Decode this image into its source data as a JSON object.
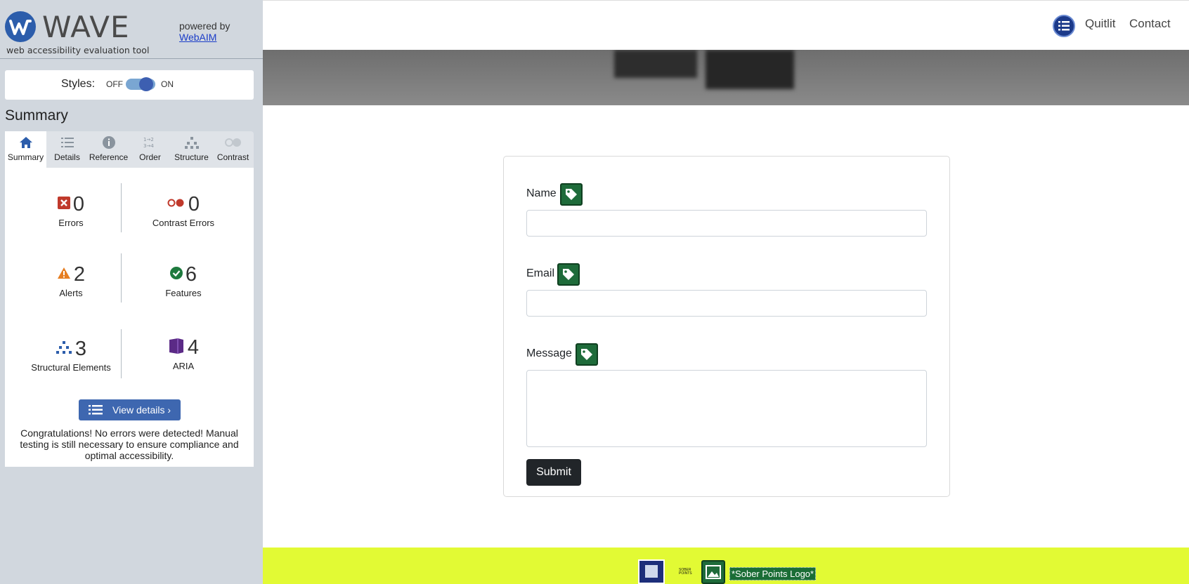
{
  "wave": {
    "title": "WAVE",
    "subtitle": "web accessibility evaluation tool",
    "powered_by": "powered by",
    "webaim_link": "WebAIM",
    "styles_label": "Styles:",
    "toggle_off": "OFF",
    "toggle_on": "ON",
    "styles_enabled": true,
    "summary_heading": "Summary",
    "tabs": [
      {
        "label": "Summary",
        "icon": "home-icon",
        "active": true
      },
      {
        "label": "Details",
        "icon": "list-icon"
      },
      {
        "label": "Reference",
        "icon": "info-icon"
      },
      {
        "label": "Order",
        "icon": "order-icon"
      },
      {
        "label": "Structure",
        "icon": "structure-icon"
      },
      {
        "label": "Contrast",
        "icon": "contrast-icon"
      }
    ],
    "stats": {
      "errors": {
        "count": "0",
        "label": "Errors",
        "icon": "error-icon",
        "color": "#c0392b"
      },
      "contrast_errors": {
        "count": "0",
        "label": "Contrast Errors",
        "icon": "contrast-error-icon",
        "color": "#c0392b"
      },
      "alerts": {
        "count": "2",
        "label": "Alerts",
        "icon": "alert-icon",
        "color": "#e67e22"
      },
      "features": {
        "count": "6",
        "label": "Features",
        "icon": "feature-icon",
        "color": "#1e7a3e"
      },
      "structural": {
        "count": "3",
        "label": "Structural Elements",
        "icon": "structure-icon",
        "color": "#2c5dab"
      },
      "aria": {
        "count": "4",
        "label": "ARIA",
        "icon": "aria-icon",
        "color": "#5b2a86"
      }
    },
    "view_details": "View details ›",
    "congrats": "Congratulations! No errors were detected! Manual testing is still necessary to ensure compliance and optimal accessibility."
  },
  "site": {
    "nav_links": [
      "Quitlit",
      "Contact"
    ],
    "form": {
      "name_label": "Name",
      "email_label": "Email",
      "message_label": "Message",
      "submit_label": "Submit"
    },
    "footer_alt_text": "*Sober Points Logo*",
    "footer_color": "#e2fa34"
  }
}
